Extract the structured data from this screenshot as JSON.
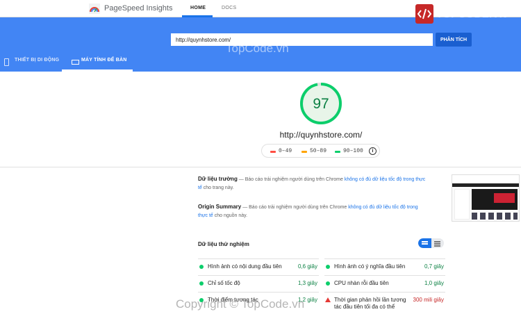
{
  "app": {
    "title": "PageSpeed Insights"
  },
  "nav": {
    "home": "HOME",
    "docs": "DOCS"
  },
  "brand": {
    "text": "TOPCODE.VN"
  },
  "search": {
    "value": "http://quynhstore.com/",
    "button": "PHÂN TÍCH"
  },
  "watermarks": {
    "top": "TopCode.vn",
    "bottom": "Copyright © TopCode.vn"
  },
  "device_tabs": {
    "mobile": "THIẾT BỊ DI ĐỘNG",
    "desktop": "MÁY TÍNH ĐỂ BÀN"
  },
  "score": {
    "value": 97,
    "url": "http://quynhstore.com/"
  },
  "legend": [
    {
      "range": "0–49",
      "color": "#ff4e42"
    },
    {
      "range": "50–89",
      "color": "#ffa400"
    },
    {
      "range": "90–100",
      "color": "#0cce6b"
    }
  ],
  "field_data": {
    "title": "Dữ liệu trường",
    "prefix": " — Báo cáo trải nghiệm người dùng trên Chrome ",
    "link": "không có đủ dữ liệu tốc độ trong thực tế",
    "suffix": " cho trang này."
  },
  "origin_summary": {
    "title": "Origin Summary",
    "prefix": " — Báo cáo trải nghiệm người dùng trên Chrome ",
    "link": "không có đủ dữ liệu tốc độ trong thực tế",
    "suffix": " cho nguồn này."
  },
  "lab_data": {
    "title": "Dữ liệu thử nghiệm",
    "metrics_left": [
      {
        "label": "Hình ảnh có nội dung đầu tiên",
        "value": "0,6 giây",
        "status": "good"
      },
      {
        "label": "Chỉ số tốc độ",
        "value": "1,3 giây",
        "status": "good"
      },
      {
        "label": "Thời điểm tương tác",
        "value": "1,2 giây",
        "status": "good"
      }
    ],
    "metrics_right": [
      {
        "label": "Hình ảnh có ý nghĩa đầu tiên",
        "value": "0,7 giây",
        "status": "good"
      },
      {
        "label": "CPU nhàn rỗi đầu tiên",
        "value": "1,0 giây",
        "status": "good"
      },
      {
        "label": "Thời gian phản hồi lần tương tác đầu tiên tối đa có thể",
        "value": "300 mili giây",
        "status": "bad"
      }
    ]
  }
}
